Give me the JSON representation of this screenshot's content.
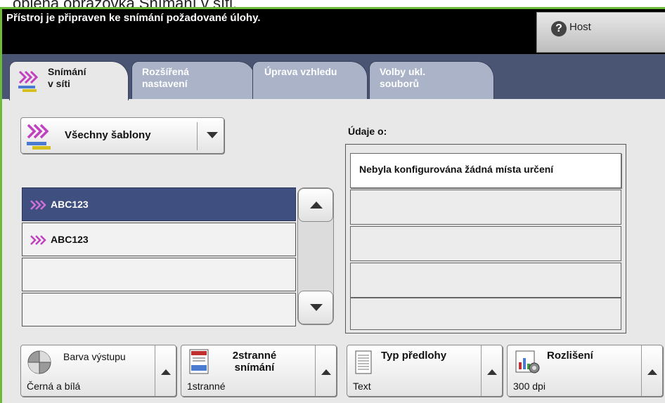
{
  "caption": "objená obrazovka Snímání v síti.",
  "status": {
    "message": "Přístroj je připraven ke snímání požadované úlohy.",
    "user_button": "Host",
    "user_icon": "help-icon"
  },
  "tabs": [
    {
      "line1": "Snímání",
      "line2": "v síti",
      "active": true
    },
    {
      "line1": "Rozšířená",
      "line2": "nastavení",
      "active": false
    },
    {
      "line1": "Úprava vzhledu",
      "line2": "",
      "active": false
    },
    {
      "line1": "Volby ukl.",
      "line2": "souborů",
      "active": false
    }
  ],
  "templates": {
    "dropdown_label": "Všechny šablony",
    "items": [
      {
        "label": "ABC123",
        "selected": true
      },
      {
        "label": "ABC123",
        "selected": false
      },
      {
        "label": "",
        "selected": false
      },
      {
        "label": "",
        "selected": false
      }
    ]
  },
  "info": {
    "title": "Údaje o:",
    "rows": [
      "Nebyla konfigurována žádná místa určení",
      "",
      "",
      "",
      ""
    ]
  },
  "features": [
    {
      "label": "Barva výstupu",
      "value": "Černá a bílá",
      "icon": "color-wheel-icon"
    },
    {
      "label": "2stranné snímání",
      "value": "1stranné",
      "icon": "two-sided-icon"
    },
    {
      "label": "Typ předlohy",
      "value": "Text",
      "icon": "document-icon"
    },
    {
      "label": "Rozlišení",
      "value": "300 dpi",
      "icon": "resolution-icon"
    }
  ],
  "colors": {
    "accent_purple": "#c040c0",
    "tab_bar": "#4a5573",
    "selected_row": "#3e4f80",
    "frame_green": "#6dbb3a"
  }
}
